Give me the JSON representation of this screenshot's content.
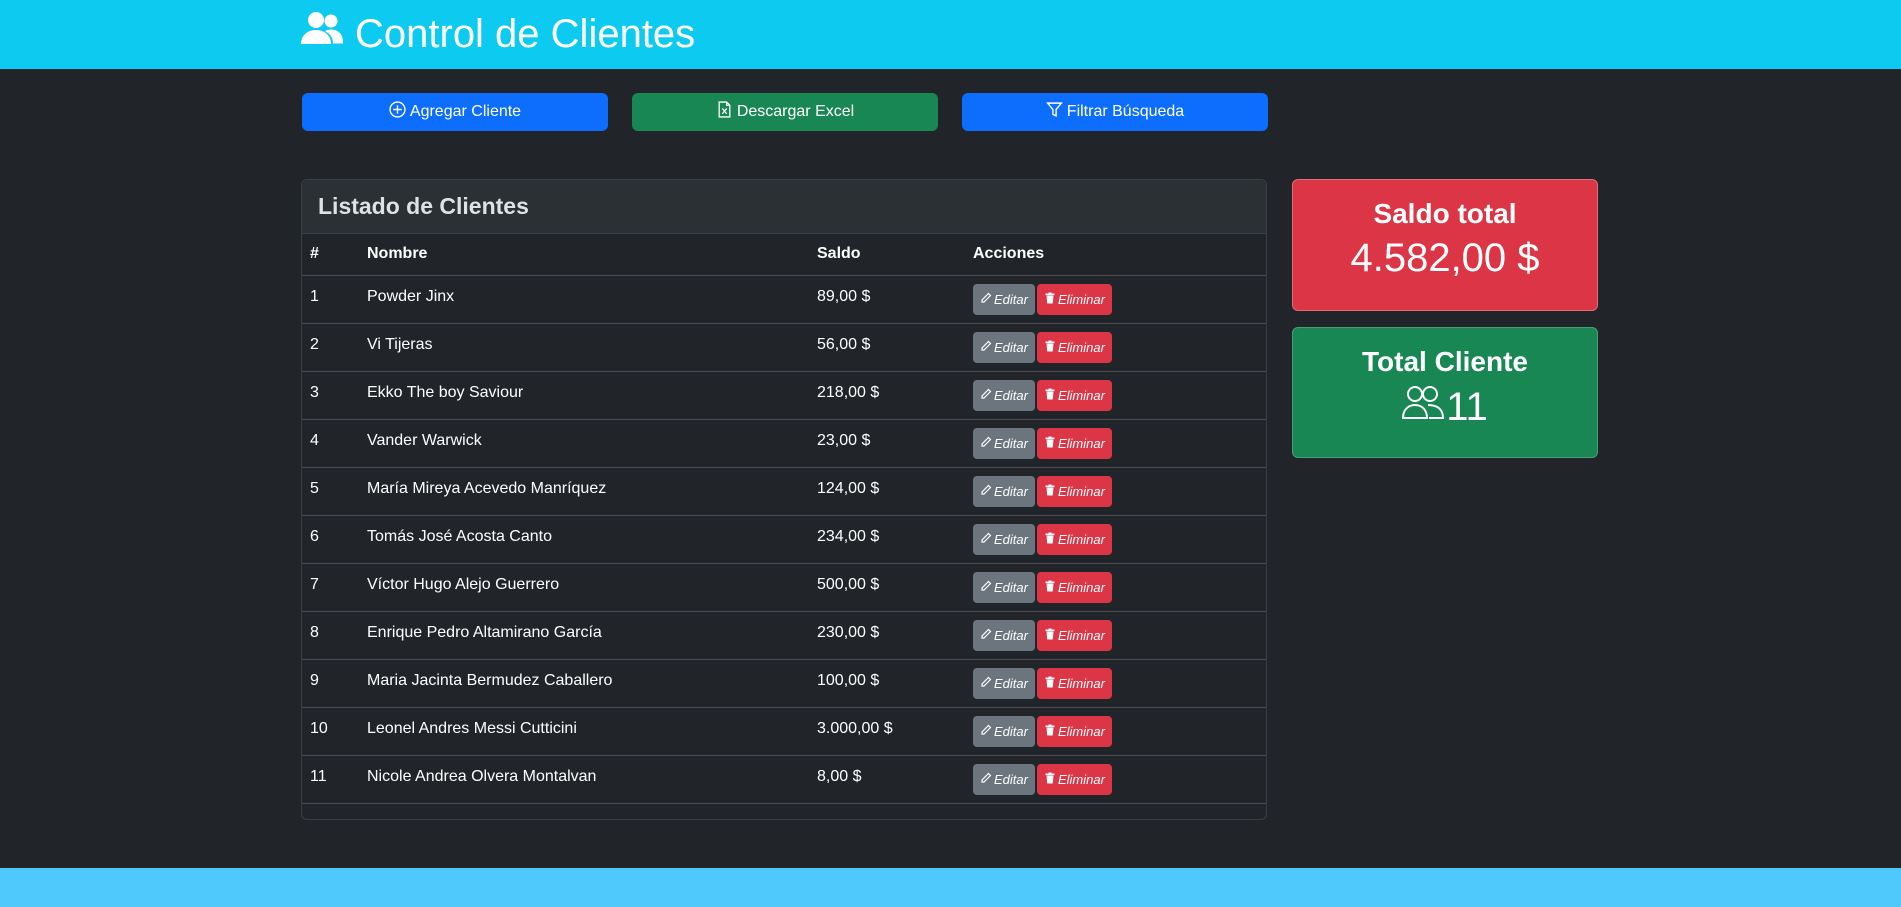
{
  "header": {
    "title": "Control de Clientes",
    "icon": "users-icon",
    "color": "#0dcaf0"
  },
  "toolbar": {
    "add_label": "Agregar Cliente",
    "excel_label": "Descargar Excel",
    "filter_label": "Filtrar Búsqueda"
  },
  "list": {
    "title": "Listado de Clientes",
    "columns": [
      "#",
      "Nombre",
      "Saldo",
      "Acciones"
    ],
    "rows": [
      {
        "num": "1",
        "name": "Powder Jinx",
        "saldo": "89,00 $"
      },
      {
        "num": "2",
        "name": "Vi Tijeras",
        "saldo": "56,00 $"
      },
      {
        "num": "3",
        "name": "Ekko The boy Saviour",
        "saldo": "218,00 $"
      },
      {
        "num": "4",
        "name": "Vander Warwick",
        "saldo": "23,00 $"
      },
      {
        "num": "5",
        "name": "María Mireya Acevedo Manríquez",
        "saldo": "124,00 $"
      },
      {
        "num": "6",
        "name": "Tomás José Acosta Canto",
        "saldo": "234,00 $"
      },
      {
        "num": "7",
        "name": "Víctor Hugo Alejo Guerrero",
        "saldo": "500,00 $"
      },
      {
        "num": "8",
        "name": "Enrique Pedro Altamirano García",
        "saldo": "230,00 $"
      },
      {
        "num": "9",
        "name": "Maria Jacinta Bermudez Caballero",
        "saldo": "100,00 $"
      },
      {
        "num": "10",
        "name": "Leonel Andres Messi Cutticini",
        "saldo": "3.000,00 $"
      },
      {
        "num": "11",
        "name": "Nicole Andrea Olvera Montalvan",
        "saldo": "8,00 $"
      }
    ],
    "edit_label": "Editar",
    "delete_label": "Eliminar"
  },
  "stats": {
    "saldo_label": "Saldo total",
    "saldo_value": "4.582,00 $",
    "clientes_label": "Total Cliente",
    "clientes_value": "11"
  },
  "colors": {
    "primary": "#0d6efd",
    "success": "#198754",
    "danger": "#dc3545",
    "secondary": "#6c757d",
    "info": "#0dcaf0"
  }
}
